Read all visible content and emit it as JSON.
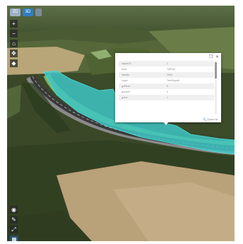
{
  "view_modes": {
    "mode_2d": "2D",
    "mode_3d": "3D",
    "mode_extra": ""
  },
  "nav_tools": [
    {
      "name": "zoom-in",
      "glyph": "+"
    },
    {
      "name": "zoom-out",
      "glyph": "−"
    },
    {
      "name": "home",
      "glyph": "⌂"
    },
    {
      "name": "pan",
      "glyph": "✥"
    },
    {
      "name": "compass",
      "glyph": "◆"
    }
  ],
  "bottom_tools": [
    {
      "name": "layers",
      "glyph": "◉"
    },
    {
      "name": "measure",
      "glyph": "✎"
    },
    {
      "name": "tilt",
      "glyph": "⤢"
    },
    {
      "name": "basemap",
      "glyph": "▦"
    }
  ],
  "popup": {
    "dock_icon": "❐",
    "close_icon": "✕",
    "rows": [
      {
        "key": "object ID",
        "value": "1"
      },
      {
        "key": "Area",
        "value": "TotFeet"
      },
      {
        "key": "Handle",
        "value": "2904"
      },
      {
        "key": "Layer",
        "value": "TreeSlopeK"
      },
      {
        "key": "gzPiece",
        "value": "0"
      },
      {
        "key": "gzLine0",
        "value": "0"
      },
      {
        "key": "gzIne",
        "value": "1"
      }
    ],
    "zoom_to": "🔍 Zoom to"
  },
  "colors": {
    "highlight": "#3ec6c4",
    "road": "#3a3a3a",
    "mode_active": "#2f7fc1"
  }
}
